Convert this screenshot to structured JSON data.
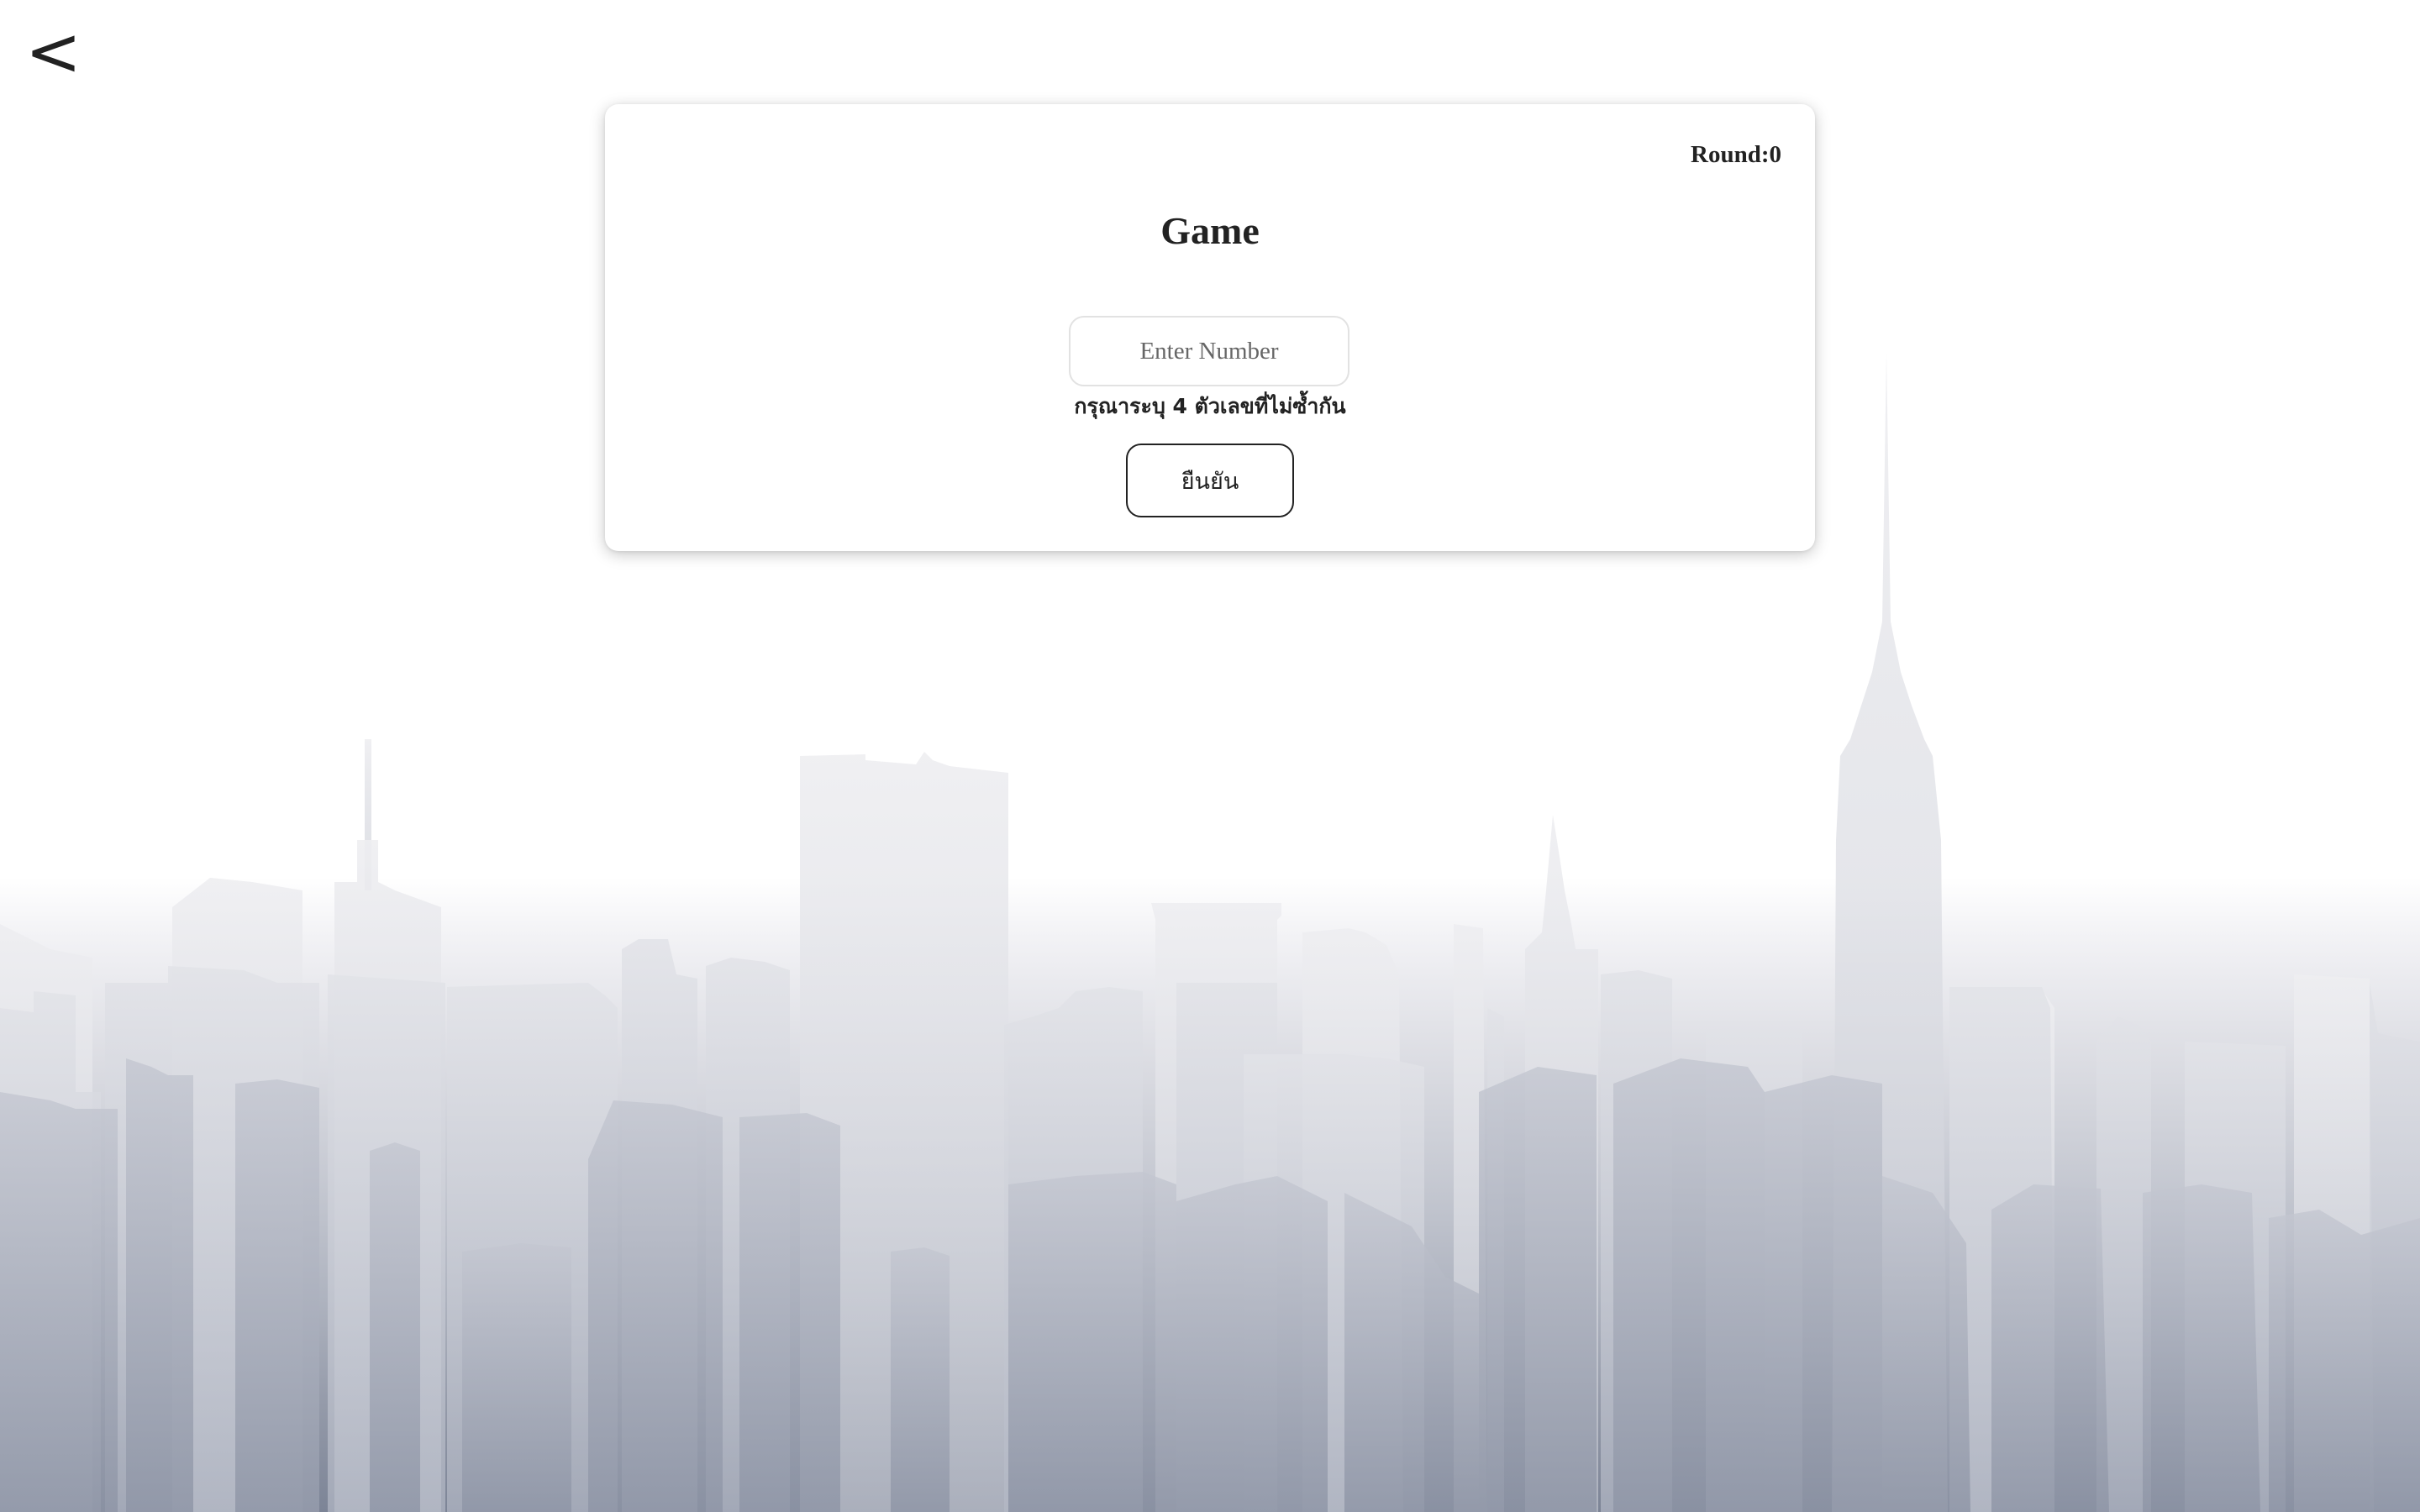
{
  "nav": {
    "back_label": "<"
  },
  "card": {
    "round_label": "Round:",
    "round_value": "0",
    "title": "Game",
    "input_placeholder": "Enter Number",
    "input_value": "",
    "hint": "กรุณาระบุ 4 ตัวเลขที่ไม่ซ้ำกัน",
    "confirm_label": "ยืนยัน"
  },
  "colors": {
    "background_top": "#ffffff",
    "background_bottom": "#7c8496",
    "skyline_light": "#ecedf1",
    "skyline_dark": "#a9afbd",
    "text": "#222222"
  },
  "icons": {
    "back": "chevron-left-icon",
    "background": "city-skyline"
  }
}
